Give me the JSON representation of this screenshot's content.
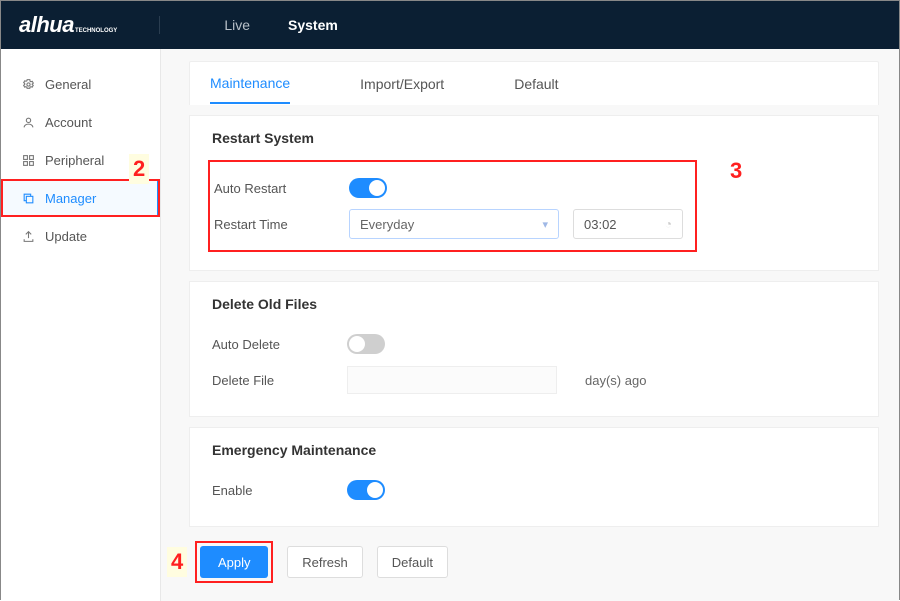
{
  "brand": "alhua",
  "brand_sub": "TECHNOLOGY",
  "header": {
    "tabs": [
      {
        "label": "Live",
        "active": false
      },
      {
        "label": "System",
        "active": true
      }
    ]
  },
  "sidebar": {
    "items": [
      {
        "label": "General",
        "icon": "gear"
      },
      {
        "label": "Account",
        "icon": "user"
      },
      {
        "label": "Peripheral",
        "icon": "grid"
      },
      {
        "label": "Manager",
        "icon": "copy",
        "active": true
      },
      {
        "label": "Update",
        "icon": "upload"
      }
    ]
  },
  "subtabs": [
    {
      "label": "Maintenance",
      "active": true
    },
    {
      "label": "Import/Export"
    },
    {
      "label": "Default"
    }
  ],
  "sections": {
    "restart": {
      "title": "Restart System",
      "auto_label": "Auto Restart",
      "auto_on": true,
      "time_label": "Restart Time",
      "period_value": "Everyday",
      "time_value": "03:02"
    },
    "delete": {
      "title": "Delete Old Files",
      "auto_label": "Auto Delete",
      "auto_on": false,
      "file_label": "Delete File",
      "file_value": "",
      "suffix": "day(s) ago"
    },
    "emergency": {
      "title": "Emergency Maintenance",
      "enable_label": "Enable",
      "enable_on": true
    }
  },
  "buttons": {
    "apply": "Apply",
    "refresh": "Refresh",
    "default": "Default"
  },
  "annotations": {
    "n2": "2",
    "n3": "3",
    "n4": "4"
  }
}
